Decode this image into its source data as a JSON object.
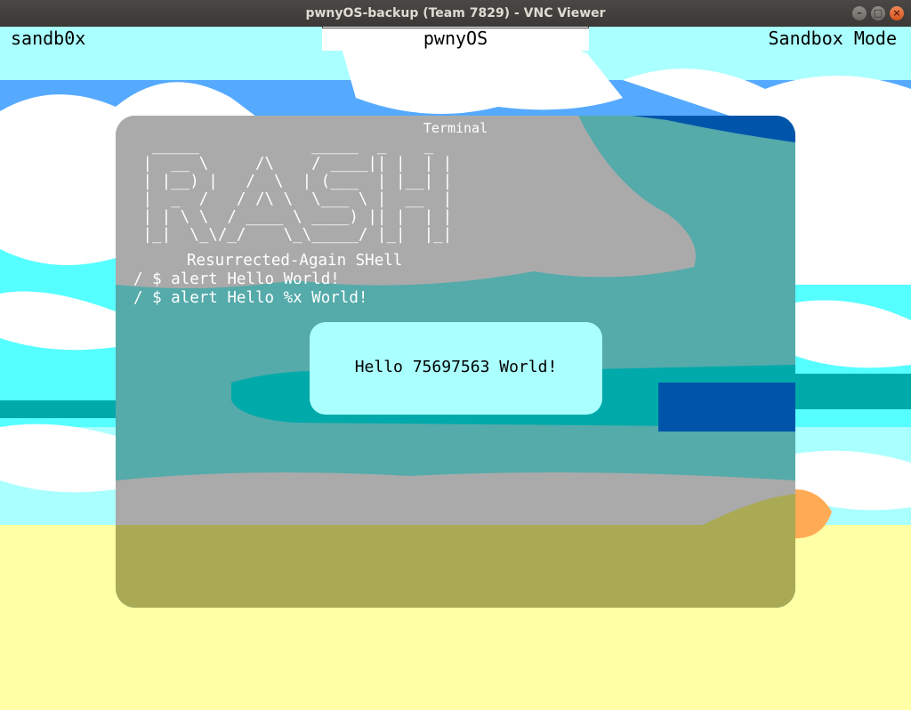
{
  "window": {
    "title": "pwnyOS-backup (Team 7829) - VNC Viewer",
    "minimize_glyph": "–",
    "maximize_glyph": "□",
    "close_glyph": "×"
  },
  "topbar": {
    "left_label": "sandb0x",
    "center_label": "pwnyOS",
    "right_label": "Sandbox Mode"
  },
  "terminal": {
    "title": "Terminal",
    "ascii_logo": "  _____            _____  _    _\n |  __ \\     /\\    / ____|| |  | |\n | |__) |   /  \\  | (___  | |__| |\n |  _  /   / /\\ \\  \\___ \\ |  __  |\n | | \\ \\  / ____ \\ ____) || |  | |\n |_|  \\_\\/_/    \\_\\_____/ |_|  |_|",
    "subtitle": "Resurrected-Again SHell",
    "lines": [
      "/ $ alert Hello World!",
      "/ $ alert Hello %x World!"
    ]
  },
  "alert": {
    "message": "Hello 75697563 World!"
  },
  "colors": {
    "topbar_bg": "#aaffff",
    "alert_bg": "#aaffff",
    "terminal_teal": "#55aaaa",
    "sand": "#ffffa6",
    "sky": "#55ffff",
    "cloud": "#ffffff",
    "sea_dark": "#0055aa"
  }
}
